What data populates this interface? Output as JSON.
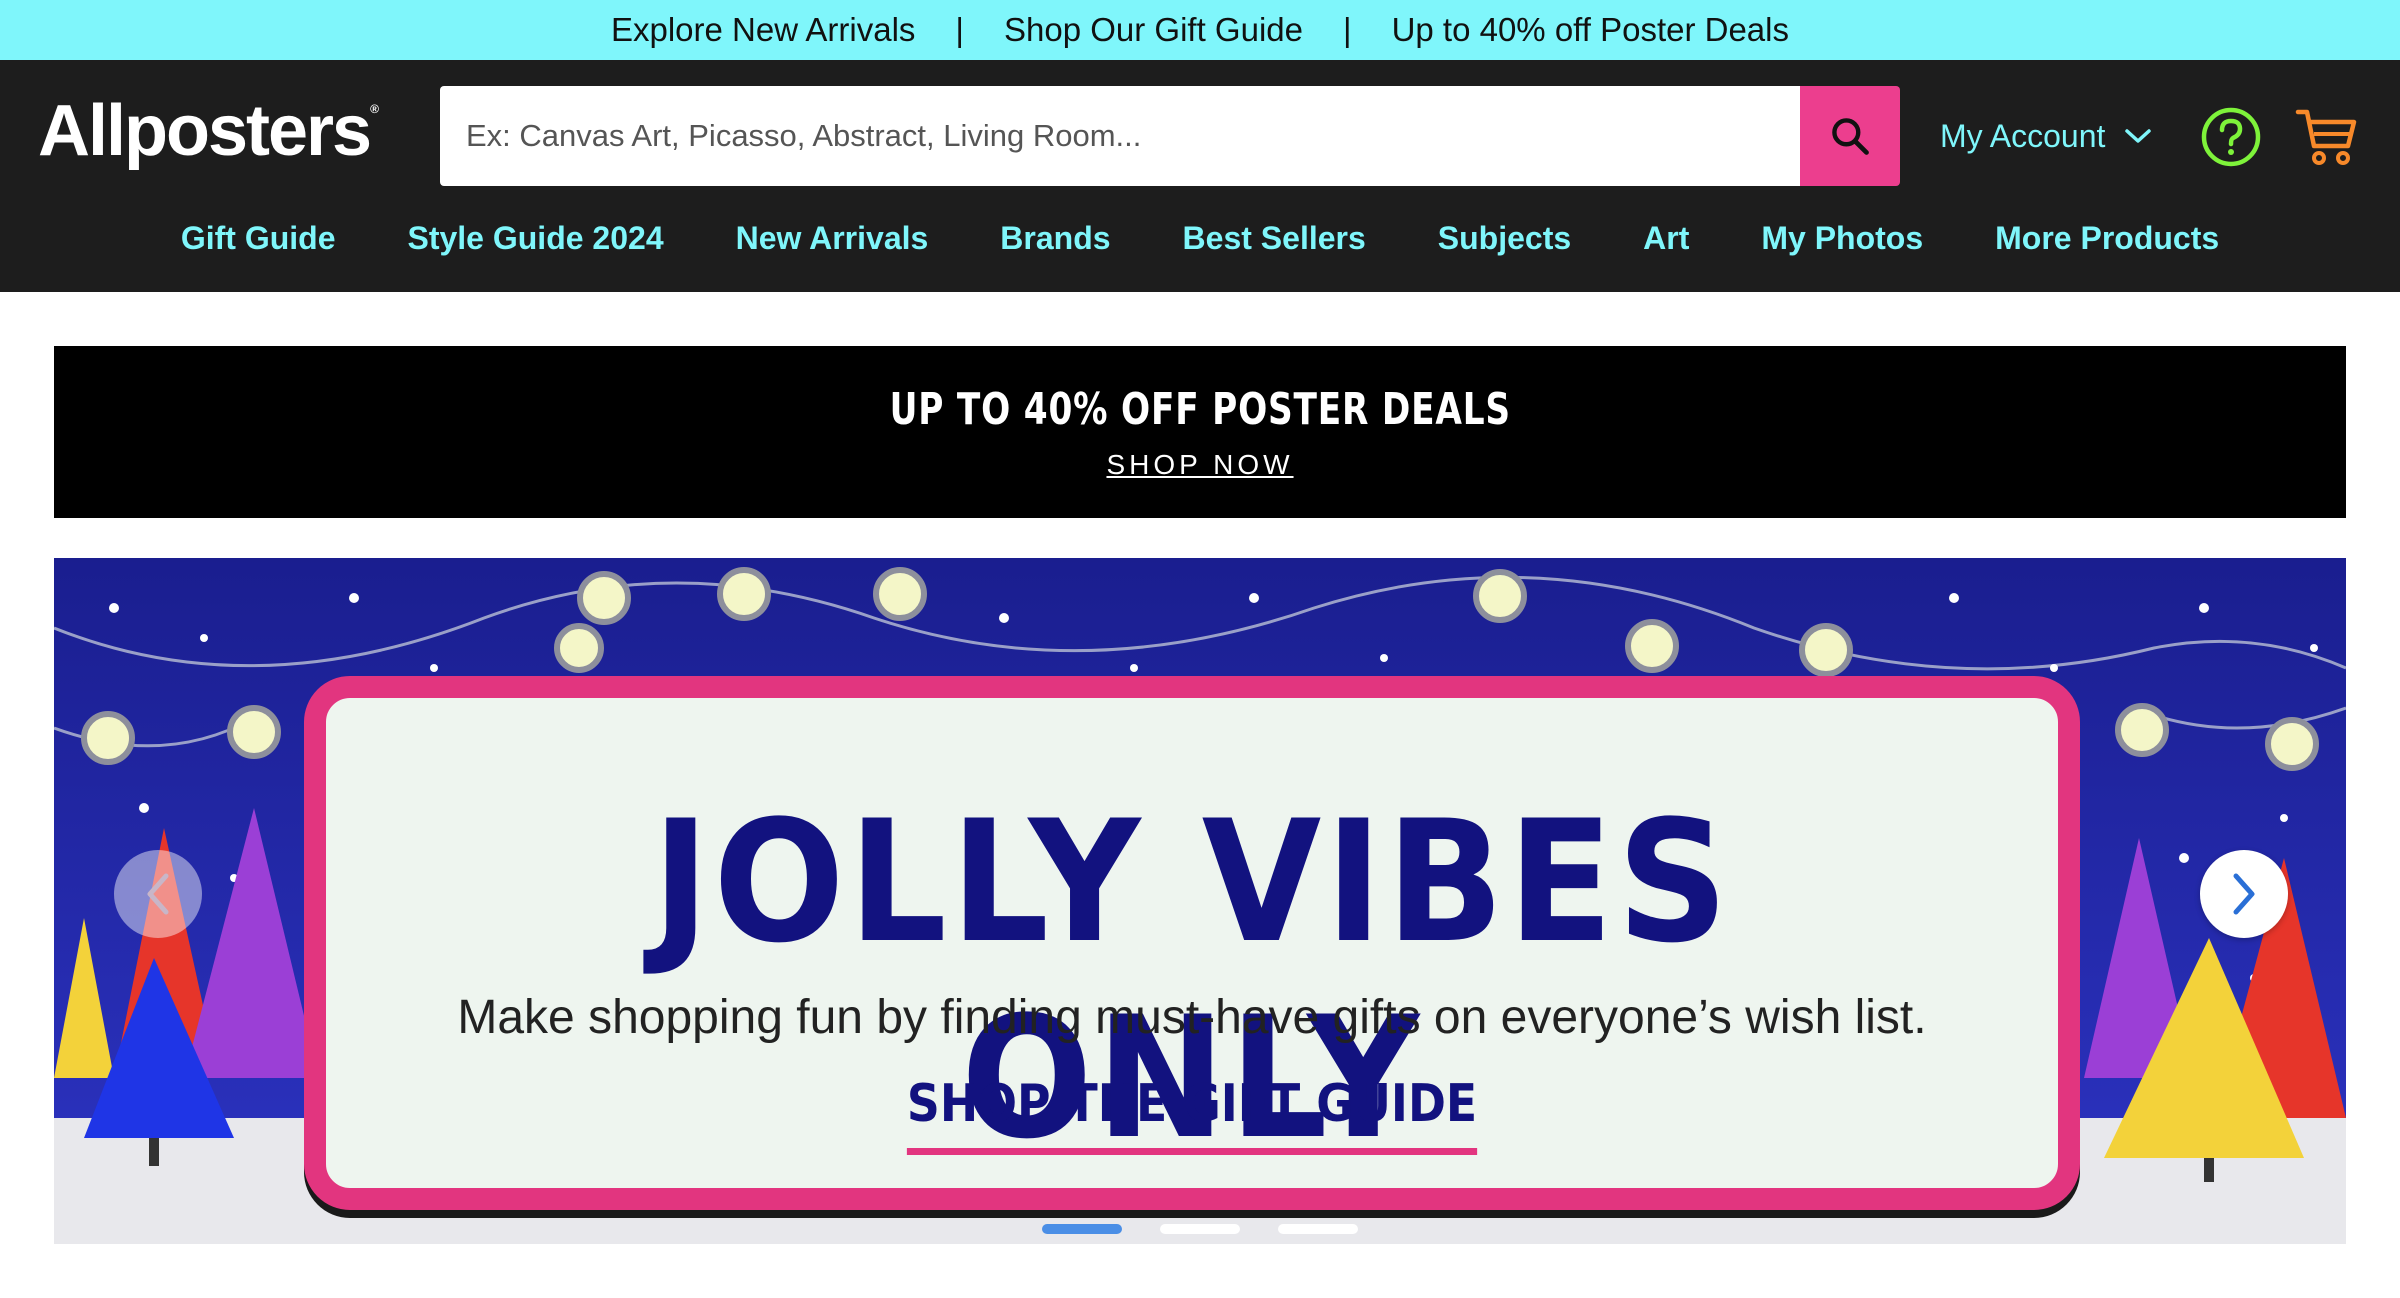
{
  "promo_strip": {
    "links": [
      "Explore New Arrivals",
      "Shop Our Gift Guide",
      "Up to 40% off Poster Deals"
    ],
    "separator": "|"
  },
  "header": {
    "logo_text": "Allposters",
    "logo_mark": "®",
    "search": {
      "placeholder": "Ex: Canvas Art, Picasso, Abstract, Living Room...",
      "value": ""
    },
    "account_label": "My Account",
    "icons": {
      "search": "search-icon",
      "help": "help-circle-icon",
      "cart": "cart-icon",
      "account_dropdown": "chevron-down-icon"
    }
  },
  "nav": {
    "items": [
      "Gift Guide",
      "Style Guide 2024",
      "New Arrivals",
      "Brands",
      "Best Sellers",
      "Subjects",
      "Art",
      "My Photos",
      "More Products"
    ]
  },
  "deal_banner": {
    "title": "UP TO 40% OFF POSTER DEALS",
    "link": "SHOP NOW"
  },
  "hero": {
    "title": "JOLLY VIBES ONLY",
    "subtitle": "Make shopping fun by finding must-have gifts on everyone’s wish list.",
    "cta": "SHOP THE GIFT GUIDE",
    "slide_count": 3,
    "active_slide": 1
  },
  "colors": {
    "promo_bg": "#7ff6fb",
    "header_bg": "#1d1d1d",
    "nav_text": "#7ff6fb",
    "search_button": "#ec3e8e",
    "help_icon": "#7ef33a",
    "cart_icon": "#f7892a",
    "hero_title": "#12127f",
    "hero_border": "#e2357f"
  }
}
